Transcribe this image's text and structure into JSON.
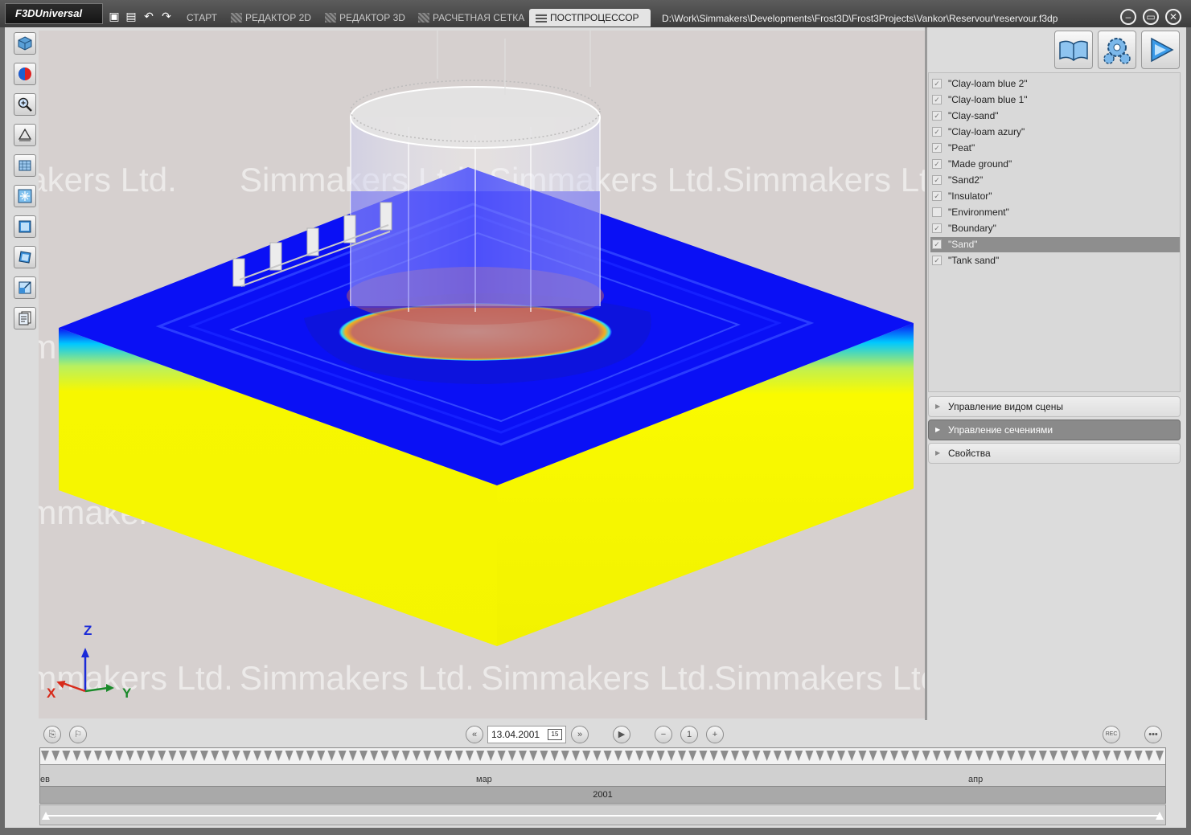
{
  "app": {
    "logo": "F3DUniversal"
  },
  "tabs": [
    {
      "label": "СТАРТ"
    },
    {
      "label": "РЕДАКТОР 2D"
    },
    {
      "label": "РЕДАКТОР 3D"
    },
    {
      "label": "РАСЧЕТНАЯ СЕТКА"
    },
    {
      "label": "ПОСТПРОЦЕССОР",
      "active": true
    }
  ],
  "file_path": "D:\\Work\\Simmakers\\Developments\\Frost3D\\Frost3Projects\\Vankor\\Reservour\\reservour.f3dp",
  "watermark": "Simmakers Ltd.",
  "axes": {
    "z": "Z",
    "x": "X",
    "y": "Y"
  },
  "layers": [
    {
      "label": "\"Clay-loam blue 2\"",
      "checked": true
    },
    {
      "label": "\"Clay-loam blue 1\"",
      "checked": true
    },
    {
      "label": "\"Clay-sand\"",
      "checked": true
    },
    {
      "label": "\"Clay-loam azury\"",
      "checked": true
    },
    {
      "label": "\"Peat\"",
      "checked": true
    },
    {
      "label": "\"Made ground\"",
      "checked": true
    },
    {
      "label": "\"Sand2\"",
      "checked": true
    },
    {
      "label": "\"Insulator\"",
      "checked": true
    },
    {
      "label": "\"Environment\"",
      "checked": false
    },
    {
      "label": "\"Boundary\"",
      "checked": true
    },
    {
      "label": "\"Sand\"",
      "checked": true,
      "selected": true
    },
    {
      "label": "\"Tank sand\"",
      "checked": true
    }
  ],
  "panels": {
    "scene_view": "Управление видом сцены",
    "sections": "Управление сечениями",
    "properties": "Свойства"
  },
  "timeline": {
    "date": "13.04.2001",
    "calendar_day": "15",
    "step": "1",
    "rec": "REC",
    "months": [
      "ев",
      "мар",
      "апр"
    ],
    "year": "2001"
  },
  "colors": {
    "field_top": "#0a10f5",
    "field_side": "#f7f700",
    "warm_zone": "#c87a72",
    "viewport_bg": "#d6d0cf"
  }
}
